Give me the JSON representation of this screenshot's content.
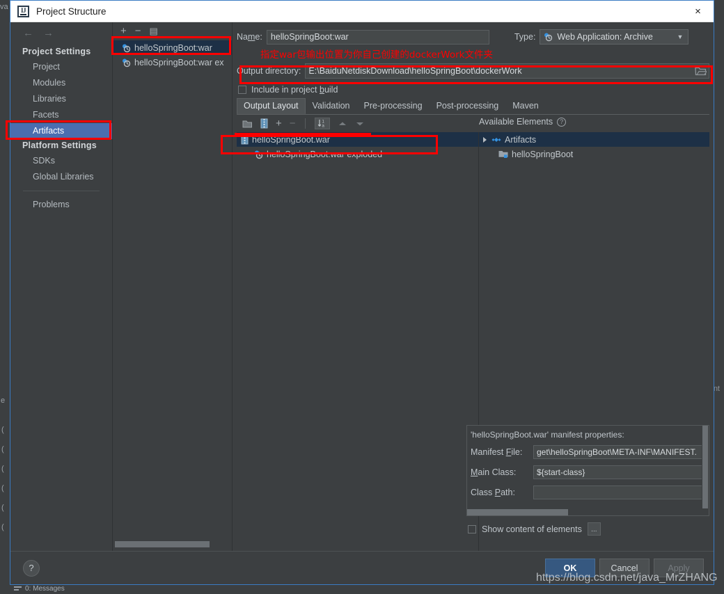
{
  "window": {
    "title": "Project Structure",
    "logo_text": "IJ",
    "close_icon": "×"
  },
  "background": {
    "left_fragments": [
      "va",
      "e",
      "(",
      "(",
      "(",
      "(",
      "(",
      "(",
      "(",
      "("
    ],
    "right_fragment": "nt",
    "statusbar_text": "0: Messages"
  },
  "nav": {
    "back_icon": "←",
    "forward_icon": "→",
    "groups": [
      {
        "header": "Project Settings",
        "items": [
          "Project",
          "Modules",
          "Libraries",
          "Facets",
          "Artifacts"
        ]
      },
      {
        "header": "Platform Settings",
        "items": [
          "SDKs",
          "Global Libraries"
        ]
      }
    ],
    "selected": "Artifacts",
    "problems": "Problems"
  },
  "artifacts_panel": {
    "toolbar": [
      {
        "name": "add-artifact-button",
        "glyph": "+"
      },
      {
        "name": "remove-artifact-button",
        "glyph": "−"
      },
      {
        "name": "copy-artifact-button",
        "glyph": "▤"
      }
    ],
    "items": [
      {
        "label": "helloSpringBoot:war",
        "selected": true
      },
      {
        "label": "helloSpringBoot:war ex",
        "selected": false
      }
    ]
  },
  "config": {
    "name_label": "Name:",
    "name_value": "helloSpringBoot:war",
    "type_label": "Type:",
    "type_value": "Web Application: Archive",
    "annotation_chinese": "指定war包输出位置为你自己创建的dockerWork文件夹",
    "output_dir_label": "Output directory:",
    "output_dir_value": "E:\\BaiduNetdiskDownload\\helloSpringBoot\\dockerWork",
    "include_in_build_label": "Include in project build",
    "include_in_build_checked": false,
    "tabs": [
      {
        "label": "Output Layout",
        "active": true
      },
      {
        "label": "Validation",
        "active": false
      },
      {
        "label": "Pre-processing",
        "active": false
      },
      {
        "label": "Post-processing",
        "active": false
      },
      {
        "label": "Maven",
        "active": false
      }
    ],
    "layout_toolbar": [
      {
        "name": "create-directory-icon",
        "glyph": "🗀"
      },
      {
        "name": "create-archive-icon",
        "glyph": "▮"
      },
      {
        "name": "add-element-icon",
        "glyph": "+"
      },
      {
        "name": "remove-element-icon",
        "glyph": "−"
      },
      {
        "name": "sort-elements-icon",
        "glyph": "1a"
      },
      {
        "name": "move-up-icon",
        "glyph": "▲"
      },
      {
        "name": "move-down-icon",
        "glyph": "▼"
      }
    ],
    "output_tree": [
      {
        "label": "helloSpringBoot.war",
        "selected": true,
        "indent": 0
      },
      {
        "label": "helloSpringBoot:war exploded",
        "selected": false,
        "indent": 1
      }
    ],
    "available_elements_label": "Available Elements",
    "available_help_icon": "?",
    "available_tree": [
      {
        "label": "Artifacts",
        "selected": true,
        "expandable": true,
        "indent": 0
      },
      {
        "label": "helloSpringBoot",
        "selected": false,
        "expandable": false,
        "indent": 1
      }
    ]
  },
  "manifest": {
    "title": "'helloSpringBoot.war' manifest properties:",
    "rows": [
      {
        "label": "Manifest File:",
        "underline": "F",
        "value": "get\\helloSpringBoot\\META-INF\\MANIFEST."
      },
      {
        "label": "Main Class:",
        "underline": "M",
        "value": "${start-class}"
      },
      {
        "label": "Class Path:",
        "underline": "P",
        "value": ""
      }
    ],
    "show_content_label": "Show content of elements",
    "show_content_checked": false,
    "dots_button": "..."
  },
  "footer": {
    "help_icon": "?",
    "buttons": [
      {
        "label": "OK",
        "style": "primary",
        "enabled": true
      },
      {
        "label": "Cancel",
        "style": "normal",
        "enabled": true
      },
      {
        "label": "Apply",
        "style": "disabled",
        "enabled": false
      }
    ]
  },
  "watermark": {
    "text": "https://blog.csdn.net/java_MrZHANG"
  },
  "colors": {
    "accent": "#4b6eaf",
    "annotation_red": "#fe0000",
    "dialog_bg": "#3c3f41",
    "selection_tree": "#1d3046",
    "primary_button": "#365880",
    "border_blue": "#3a7cc4"
  }
}
